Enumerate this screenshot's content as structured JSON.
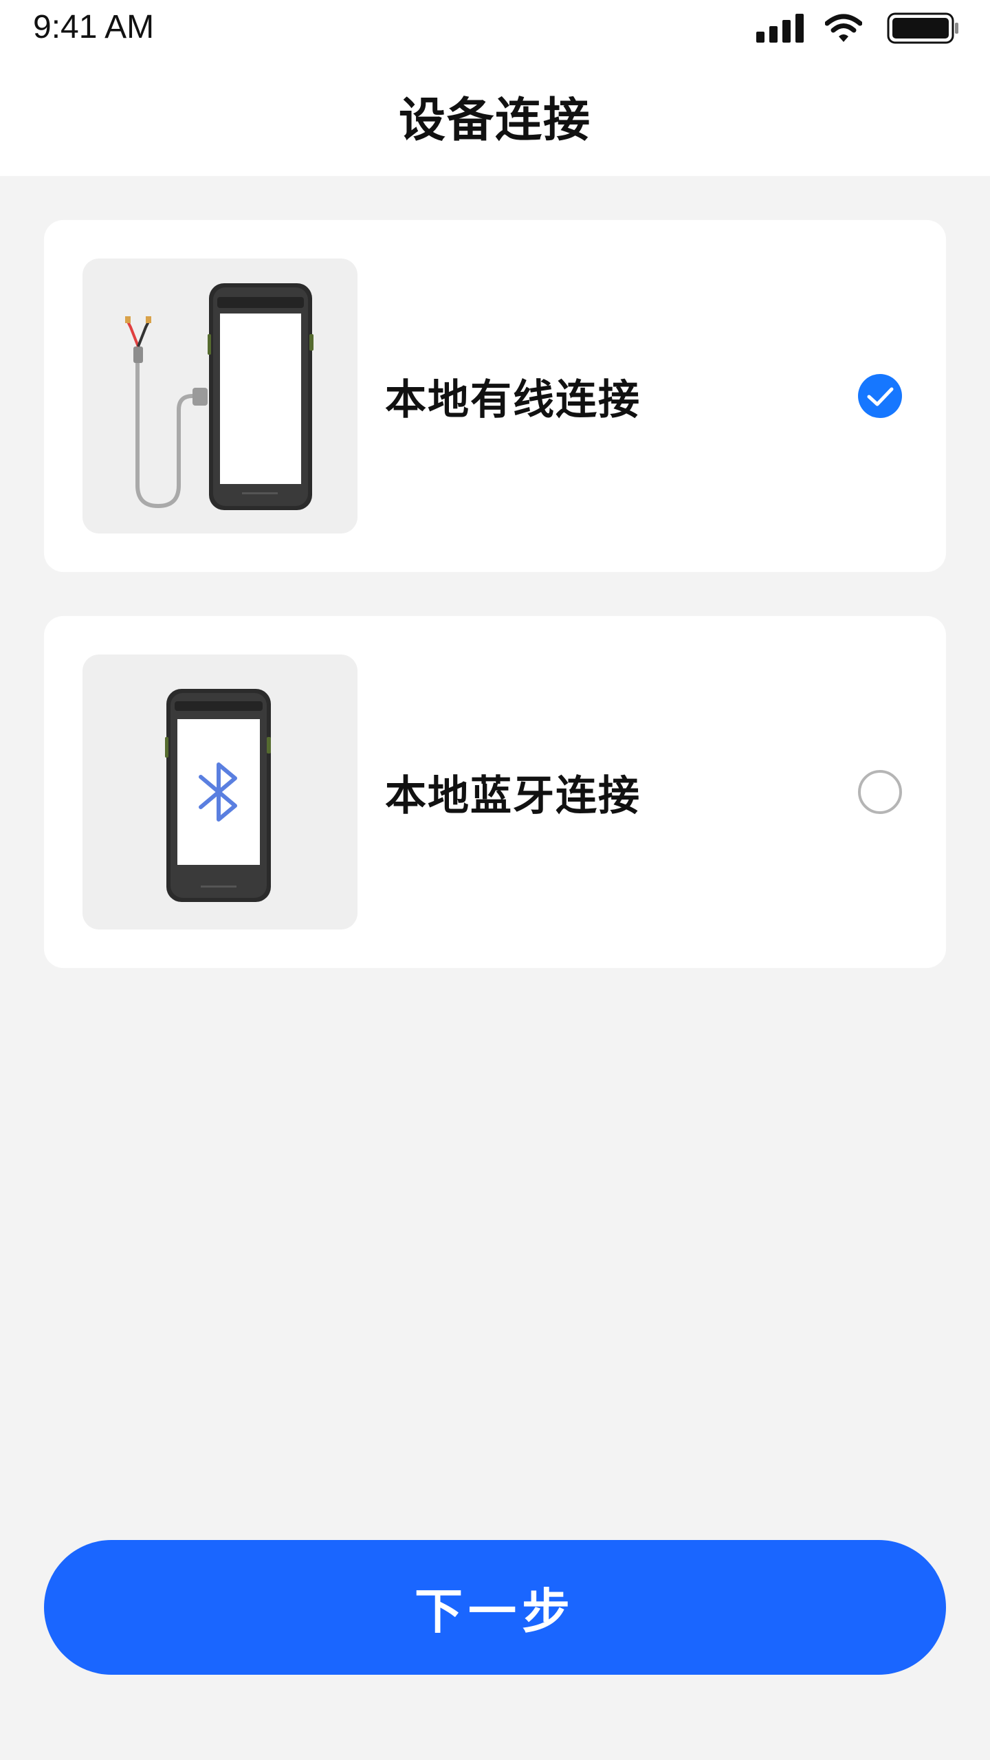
{
  "status_bar": {
    "time": "9:41 AM",
    "icons": [
      "signal-bars-icon",
      "wifi-icon",
      "battery-icon"
    ]
  },
  "header": {
    "title": "设备连接"
  },
  "options": [
    {
      "label": "本地有线连接",
      "image": "phone-with-cable-illustration",
      "selected": true
    },
    {
      "label": "本地蓝牙连接",
      "image": "phone-with-bluetooth-illustration",
      "selected": false
    }
  ],
  "footer": {
    "next_label": "下一步"
  },
  "colors": {
    "accent": "#1677ff",
    "button": "#1a66ff",
    "background": "#f3f3f3",
    "card": "#ffffff",
    "bluetooth_symbol": "#5a7fe0"
  }
}
